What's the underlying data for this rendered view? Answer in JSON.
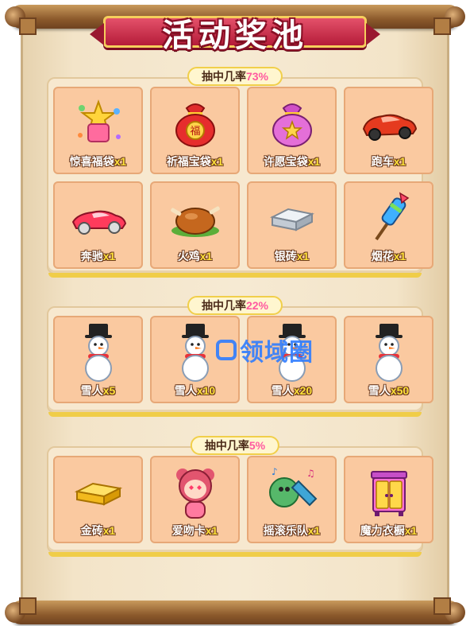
{
  "banner": {
    "title": "活动奖池"
  },
  "sections": [
    {
      "label_prefix": "抽中几率",
      "rate": "73%",
      "items": [
        {
          "name": "惊喜福袋",
          "qty": "x1",
          "icon": "surprise-lucky-bag-icon"
        },
        {
          "name": "祈福宝袋",
          "qty": "x1",
          "icon": "blessing-treasure-bag-icon"
        },
        {
          "name": "许愿宝袋",
          "qty": "x1",
          "icon": "wish-treasure-bag-icon"
        },
        {
          "name": "跑车",
          "qty": "x1",
          "icon": "sports-car-icon"
        },
        {
          "name": "奔驰",
          "qty": "x1",
          "icon": "benz-car-icon"
        },
        {
          "name": "火鸡",
          "qty": "x1",
          "icon": "roast-turkey-icon"
        },
        {
          "name": "银砖",
          "qty": "x1",
          "icon": "silver-brick-icon"
        },
        {
          "name": "烟花",
          "qty": "x1",
          "icon": "firework-rocket-icon"
        }
      ]
    },
    {
      "label_prefix": "抽中几率",
      "rate": "22%",
      "items": [
        {
          "name": "雪人",
          "qty": "x5",
          "icon": "snowman-icon"
        },
        {
          "name": "雪人",
          "qty": "x10",
          "icon": "snowman-icon"
        },
        {
          "name": "雪人",
          "qty": "x20",
          "icon": "snowman-icon"
        },
        {
          "name": "雪人",
          "qty": "x50",
          "icon": "snowman-icon"
        }
      ]
    },
    {
      "label_prefix": "抽中几率",
      "rate": "5%",
      "items": [
        {
          "name": "金砖",
          "qty": "x1",
          "icon": "gold-brick-icon"
        },
        {
          "name": "爱吻卡",
          "qty": "x1",
          "icon": "love-kiss-card-icon"
        },
        {
          "name": "摇滚乐队",
          "qty": "x1",
          "icon": "rock-band-icon"
        },
        {
          "name": "魔力衣橱",
          "qty": "x1",
          "icon": "magic-wardrobe-icon"
        }
      ]
    }
  ],
  "watermark": {
    "text": "领域圈"
  }
}
